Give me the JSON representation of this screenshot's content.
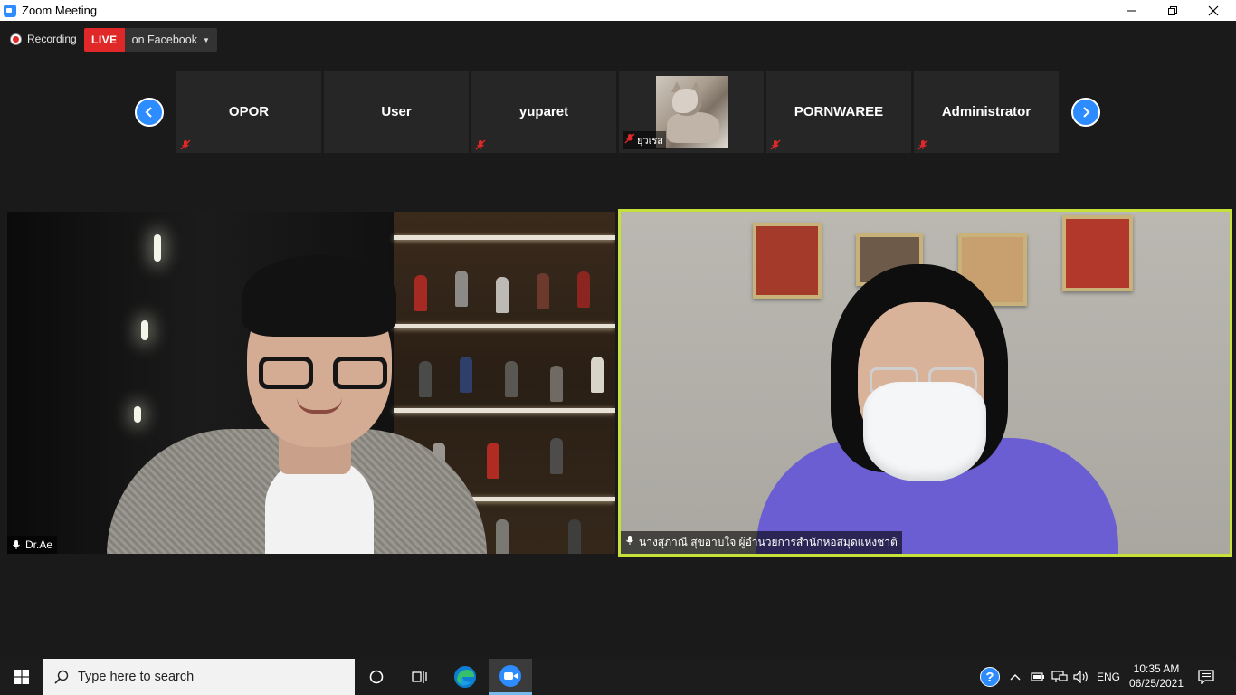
{
  "window": {
    "title": "Zoom Meeting",
    "minimize_icon": "minimize-icon",
    "restore_icon": "restore-icon",
    "close_icon": "close-icon"
  },
  "recording": {
    "label": "Recording"
  },
  "live": {
    "badge": "LIVE",
    "destination": "on Facebook"
  },
  "thumbnails": [
    {
      "name": "OPOR",
      "muted": true
    },
    {
      "name": "User",
      "muted": false
    },
    {
      "name": "yuparet",
      "muted": true
    },
    {
      "name": "ยุวเรส",
      "muted": true,
      "has_photo": true
    },
    {
      "name": "PORNWAREE",
      "muted": true
    },
    {
      "name": "Administrator",
      "muted": true
    }
  ],
  "videos": {
    "left": {
      "name": "Dr.Ae"
    },
    "right": {
      "name": "นางสุภาณี สุขอาบใจ ผู้อำนวยการสำนักหอสมุดแห่งชาติ",
      "active_speaker": true
    }
  },
  "colors": {
    "accent": "#2d8cff",
    "live_red": "#e02828",
    "active_speaker_border": "#c6e23a"
  },
  "taskbar": {
    "search_placeholder": "Type here to search",
    "language": "ENG",
    "time": "10:35 AM",
    "date": "06/25/2021"
  }
}
